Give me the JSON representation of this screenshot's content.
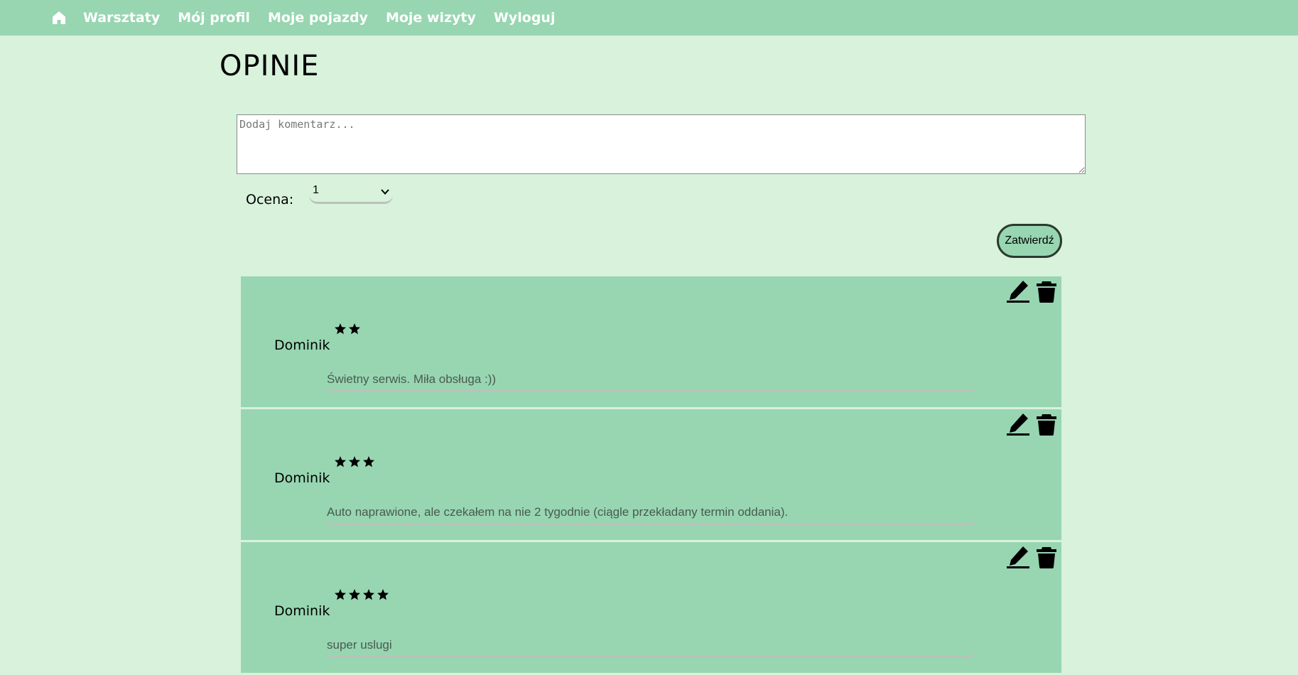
{
  "nav": {
    "home_icon": "home-icon",
    "links": [
      "Warsztaty",
      "Mój profil",
      "Moje pojazdy",
      "Moje wizyty",
      "Wyloguj"
    ]
  },
  "page": {
    "title": "OPINIE"
  },
  "form": {
    "comment_placeholder": "Dodaj komentarz...",
    "comment_value": "",
    "rating_label": "Ocena:",
    "rating_selected": "1",
    "submit_label": "Zatwierdź"
  },
  "reviews": [
    {
      "author": "Dominik",
      "stars": 2,
      "text": "Świetny serwis. Miła obsługa :))"
    },
    {
      "author": "Dominik",
      "stars": 3,
      "text": "Auto naprawione, ale czekałem na nie 2 tygodnie (ciągle przekładany termin oddania)."
    },
    {
      "author": "Dominik",
      "stars": 4,
      "text": "super uslugi"
    }
  ],
  "colors": {
    "background": "#d8f2dc",
    "nav_and_cards": "#97d6b1",
    "nav_text": "#ffffff"
  },
  "icons": {
    "edit": "pencil-icon",
    "delete": "trash-icon",
    "star": "star-icon"
  }
}
